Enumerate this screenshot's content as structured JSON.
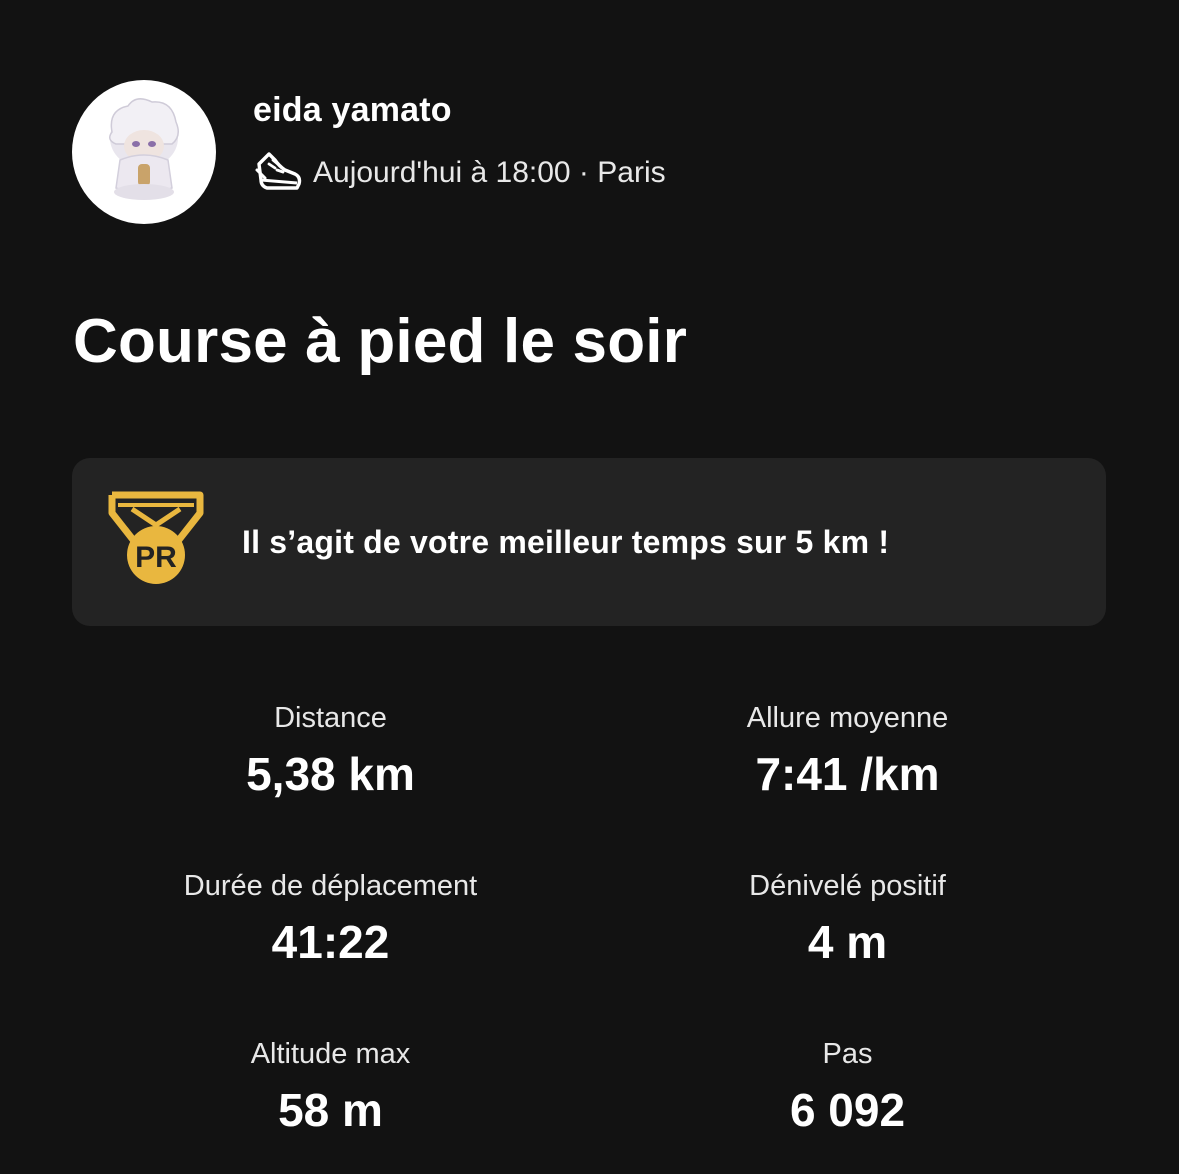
{
  "user": {
    "name": "eida yamato",
    "meta": "Aujourd'hui à 18:00 · Paris",
    "activity_icon": "running-shoe-icon"
  },
  "activity": {
    "title": "Course à pied le soir"
  },
  "pr_banner": {
    "icon": "pr-medal-icon",
    "badge_text": "PR",
    "text": "Il s’agit de votre meilleur temps sur 5 km !",
    "accent_color": "#E9B73F"
  },
  "stats": [
    {
      "label": "Distance",
      "value": "5,38 km"
    },
    {
      "label": "Allure moyenne",
      "value": "7:41 /km"
    },
    {
      "label": "Durée de déplacement",
      "value": "41:22"
    },
    {
      "label": "Dénivelé positif",
      "value": "4 m"
    },
    {
      "label": "Altitude max",
      "value": "58 m"
    },
    {
      "label": "Pas",
      "value": "6 092"
    }
  ]
}
